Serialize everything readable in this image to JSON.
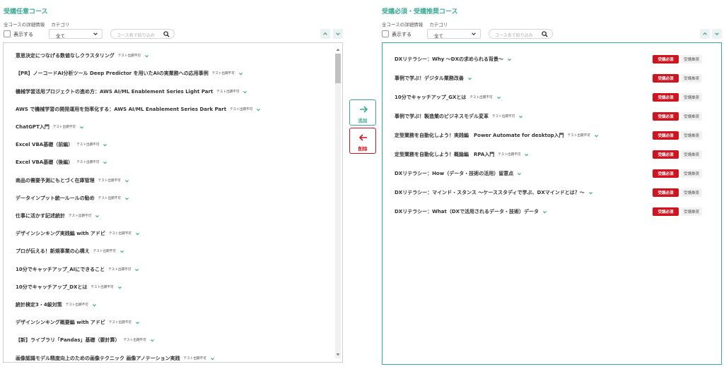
{
  "colors": {
    "accent": "#3aaa94",
    "required": "#d0141f",
    "border": "#cfcfcf"
  },
  "left": {
    "title": "受講任意コース",
    "subtabs": [
      "全コースの詳細情報",
      "カテゴリ"
    ],
    "show_label": "表示する",
    "filter_value": "全て",
    "search_placeholder": "コース名で絞り込み",
    "items": [
      {
        "name": "意思決定につなげる数値なしクラスタリング",
        "tag": "テスト出題不可"
      },
      {
        "name": "【PR】ノーコードAI分析ツール Deep Predictor を用いたAIの実業務への応用事例",
        "tag": "テスト出題不可"
      },
      {
        "name": "機械学習活用プロジェクトの進め方：AWS AI/ML Enablement Series Light Part",
        "tag": "テスト出題不可"
      },
      {
        "name": "AWS で機械学習の開発運用を効率化する：AWS AI/ML Enablement Series Dark Part",
        "tag": "テスト出題不可"
      },
      {
        "name": "ChatGPT入門",
        "tag": "テスト出題不可"
      },
      {
        "name": "Excel VBA基礎（前編）",
        "tag": "テスト出題不可"
      },
      {
        "name": "Excel VBA基礎（後編）",
        "tag": "テスト出題不可"
      },
      {
        "name": "商品の需要予測にもとづく在庫管理",
        "tag": "テスト出題不可"
      },
      {
        "name": "データインプット統一ルールの勧め",
        "tag": "テスト出題不可"
      },
      {
        "name": "仕事に活かす記述統計",
        "tag": "テスト出題不可"
      },
      {
        "name": "デザインシンキング実践編 with アドビ",
        "tag": "テスト出題不可"
      },
      {
        "name": "プロが伝える！新規事業の心構え",
        "tag": "テスト出題不可"
      },
      {
        "name": "10分でキャッチアップ_AIにできること",
        "tag": "テスト出題不可"
      },
      {
        "name": "10分でキャッチアップ_DXとは",
        "tag": "テスト出題不可"
      },
      {
        "name": "統計検定3・4級対策",
        "tag": "テスト出題不可"
      },
      {
        "name": "デザインシンキング概要編 with アドビ",
        "tag": "テスト出題不可"
      },
      {
        "name": "【新】ライブラリ「Pandas」基礎（要計算）",
        "tag": "テスト出題不可"
      },
      {
        "name": "画像認識モデル精度向上のための画像テクニック 画像アノテーション実践",
        "tag": "テスト出題不可"
      }
    ]
  },
  "right": {
    "title": "受講必須・受講推奨コース",
    "subtabs": [
      "全コースの詳細情報",
      "カテゴリ"
    ],
    "show_label": "表示する",
    "filter_value": "全て",
    "search_placeholder": "コース名で絞り込み",
    "badge_required": "受講必須",
    "badge_recommended": "受講推奨",
    "items": [
      {
        "name": "DXリテラシー：Why 〜DXの求められる背景〜",
        "tag": ""
      },
      {
        "name": "事例で学ぶ！デジタル業務改善",
        "tag": ""
      },
      {
        "name": "10分でキャッチアップ_GXとは",
        "tag": "テスト出題不可"
      },
      {
        "name": "事例で学ぶ！製造業のビジネスモデル変革",
        "tag": "テスト出題不可"
      },
      {
        "name": "定型業務を自動化しよう！実践編　Power Automate for desktop入門",
        "tag": "テスト出題不可"
      },
      {
        "name": "定型業務を自動化しよう！概論編　RPA入門",
        "tag": "テスト出題不可"
      },
      {
        "name": "DXリテラシー：How（データ・技術の活用）留意点",
        "tag": ""
      },
      {
        "name": "DXリテラシー：マインド・スタンス 〜ケーススタディで学ぶ、DXマインドとは？〜",
        "tag": ""
      },
      {
        "name": "DXリテラシー：What（DXで活用されるデータ・技術）データ",
        "tag": ""
      }
    ]
  },
  "transfer": {
    "add_label": "追加",
    "remove_label": "削除"
  }
}
